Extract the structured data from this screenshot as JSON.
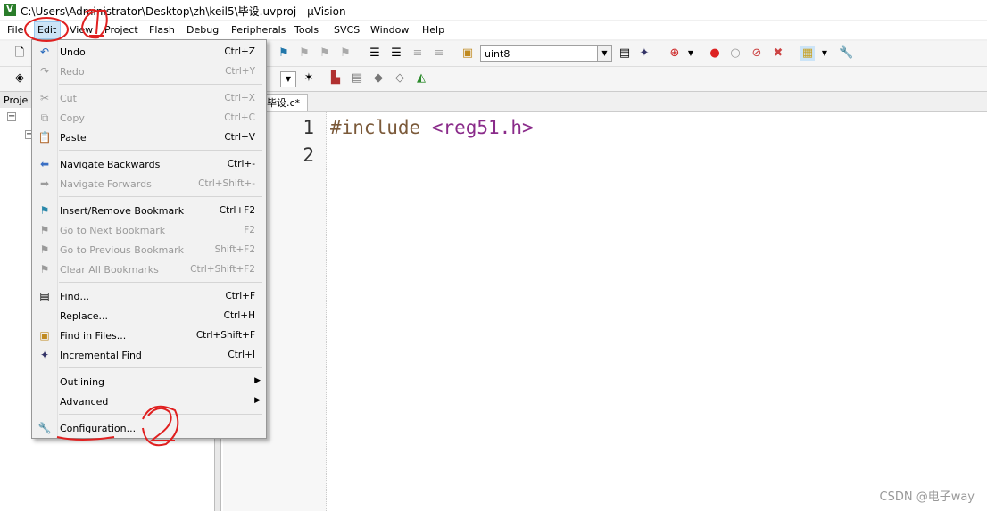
{
  "window": {
    "title": "C:\\Users\\Administrator\\Desktop\\zh\\keil5\\毕设.uvproj - µVision"
  },
  "menubar": {
    "items": [
      "File",
      "Edit",
      "View",
      "Project",
      "Flash",
      "Debug",
      "Peripherals",
      "Tools",
      "SVCS",
      "Window",
      "Help"
    ]
  },
  "toolbar": {
    "target_value": "uint8"
  },
  "project_panel": {
    "label": "Proje"
  },
  "editor": {
    "tab": "毕设.c*",
    "lines": [
      {
        "num": "1",
        "directive": "#include",
        "header": "<reg51.h>"
      },
      {
        "num": "2"
      }
    ]
  },
  "edit_menu": {
    "items": [
      {
        "label": "Undo",
        "shortcut": "Ctrl+Z",
        "icon": "undo-icon",
        "enabled": true
      },
      {
        "label": "Redo",
        "shortcut": "Ctrl+Y",
        "icon": "redo-icon",
        "enabled": false
      },
      {
        "label": "Cut",
        "shortcut": "Ctrl+X",
        "icon": "cut-icon",
        "enabled": false
      },
      {
        "label": "Copy",
        "shortcut": "Ctrl+C",
        "icon": "copy-icon",
        "enabled": false
      },
      {
        "label": "Paste",
        "shortcut": "Ctrl+V",
        "icon": "paste-icon",
        "enabled": true
      },
      {
        "label": "Navigate Backwards",
        "shortcut": "Ctrl+-",
        "icon": "arrow-left-icon",
        "enabled": true
      },
      {
        "label": "Navigate Forwards",
        "shortcut": "Ctrl+Shift+-",
        "icon": "arrow-right-icon",
        "enabled": false
      },
      {
        "label": "Insert/Remove Bookmark",
        "shortcut": "Ctrl+F2",
        "icon": "bookmark-icon",
        "enabled": true
      },
      {
        "label": "Go to Next Bookmark",
        "shortcut": "F2",
        "icon": "next-bookmark-icon",
        "enabled": false
      },
      {
        "label": "Go to Previous Bookmark",
        "shortcut": "Shift+F2",
        "icon": "prev-bookmark-icon",
        "enabled": false
      },
      {
        "label": "Clear All Bookmarks",
        "shortcut": "Ctrl+Shift+F2",
        "icon": "clear-bookmarks-icon",
        "enabled": false
      },
      {
        "label": "Find...",
        "shortcut": "Ctrl+F",
        "icon": "find-icon",
        "enabled": true
      },
      {
        "label": "Replace...",
        "shortcut": "Ctrl+H",
        "icon": "",
        "enabled": true
      },
      {
        "label": "Find in Files...",
        "shortcut": "Ctrl+Shift+F",
        "icon": "find-in-files-icon",
        "enabled": true
      },
      {
        "label": "Incremental Find",
        "shortcut": "Ctrl+I",
        "icon": "incremental-find-icon",
        "enabled": true
      },
      {
        "label": "Outlining",
        "shortcut": "",
        "icon": "",
        "enabled": true,
        "submenu": true
      },
      {
        "label": "Advanced",
        "shortcut": "",
        "icon": "",
        "enabled": true,
        "submenu": true
      },
      {
        "label": "Configuration...",
        "shortcut": "",
        "icon": "wrench-icon",
        "enabled": true
      }
    ]
  },
  "watermark": "CSDN @电子way",
  "colors": {
    "annotation": "#e02020",
    "menu_highlight": "#cce4f7"
  }
}
